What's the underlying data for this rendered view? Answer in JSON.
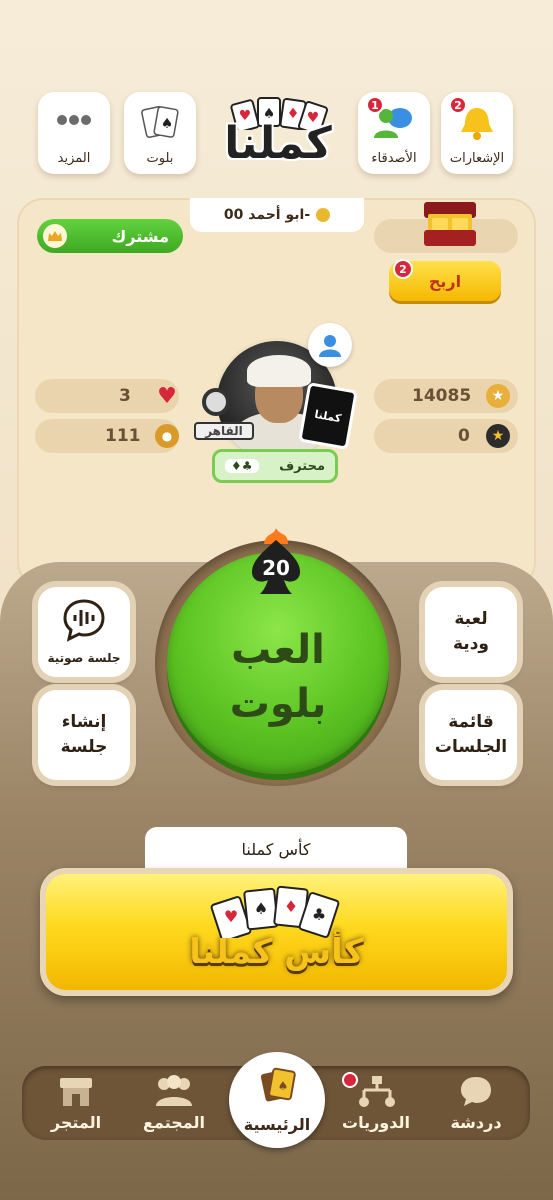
{
  "top_bar": {
    "notifications": {
      "label": "الإشعارات",
      "badge": "2",
      "icon": "bell-icon"
    },
    "friends": {
      "label": "الأصدقاء",
      "badge": "1",
      "icon": "friends-icon"
    },
    "logo": {
      "text": "كملنا"
    },
    "baloot": {
      "label": "بلوت",
      "icon": "cards-icon"
    },
    "more": {
      "label": "المزيد",
      "icon": "more-dots-icon"
    }
  },
  "profile": {
    "name": "ابو أحمد 00-",
    "subscription_label": "مشترك",
    "win_button_label": "اربح",
    "win_badge": "2",
    "stats": {
      "points": "14085",
      "stars": "0",
      "hearts": "3",
      "medals": "111"
    },
    "rank_label": "محترف",
    "rank_suits": "♦♣",
    "emblem_text": "القاهر",
    "card_text": "كملنا"
  },
  "play": {
    "badge_number": "20",
    "main_line1": "العب",
    "main_line2": "بلوت",
    "voice_session": "جلسة صوتية",
    "create_session_line1": "إنشاء",
    "create_session_line2": "جلسة",
    "friendly_game_line1": "لعبة",
    "friendly_game_line2": "ودية",
    "sessions_list_line1": "قائمة",
    "sessions_list_line2": "الجلسات"
  },
  "cup": {
    "tab_label": "كأس كملنا",
    "banner_text": "كأس كملنا"
  },
  "bottom_nav": {
    "store": "المتجر",
    "community": "المجتمع",
    "home": "الرئيسية",
    "tournaments": "الدوريات",
    "chat": "دردشة"
  },
  "colors": {
    "accent_green": "#5bc322",
    "notif_red": "#d6283a",
    "gold": "#f5b800",
    "nav_brown": "#6e5538"
  }
}
